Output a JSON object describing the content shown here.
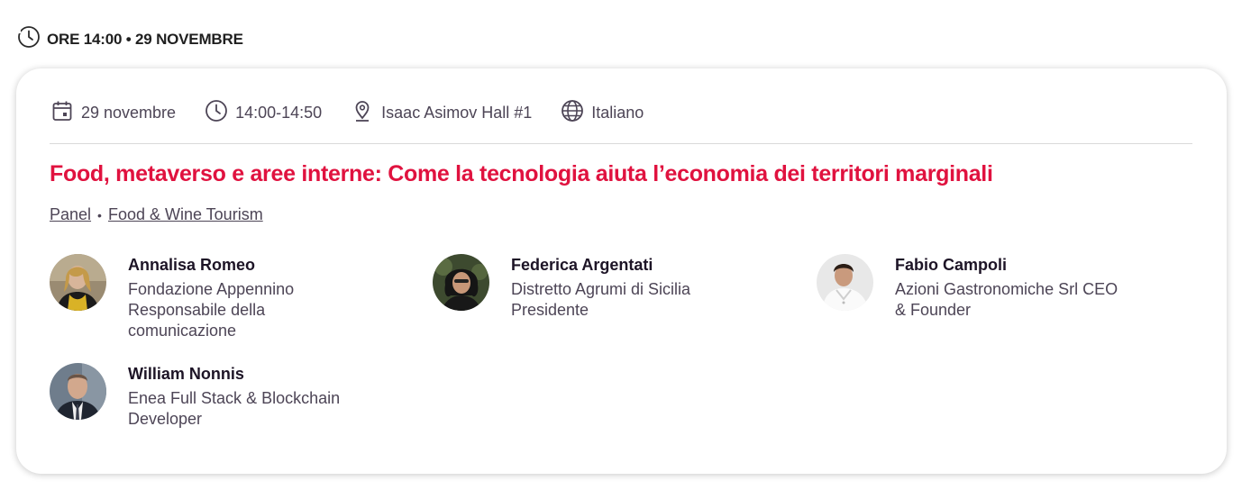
{
  "header": {
    "time_label": "ORE 14:00 • 29 NOVEMBRE",
    "icon": "clock-icon"
  },
  "event": {
    "date": "29 novembre",
    "time": "14:00-14:50",
    "location": "Isaac Asimov Hall #1",
    "language": "Italiano",
    "title": "Food, metaverso e aree interne: Come la tecnologia aiuta l’economia dei territori marginali",
    "tags": [
      "Panel",
      "Food & Wine Tourism"
    ]
  },
  "speakers": [
    {
      "name": "Annalisa Romeo",
      "role": "Fondazione Appennino Responsabile della comunicazione"
    },
    {
      "name": "Federica Argentati",
      "role": "Distretto Agrumi di Sicilia Presidente"
    },
    {
      "name": "Fabio Campoli",
      "role": "Azioni Gastronomiche Srl CEO & Founder"
    },
    {
      "name": "William Nonnis",
      "role": "Enea Full Stack & Blockchain Developer"
    }
  ],
  "colors": {
    "accent": "#e0123f",
    "text": "#4d4556",
    "heading": "#1d1426"
  }
}
